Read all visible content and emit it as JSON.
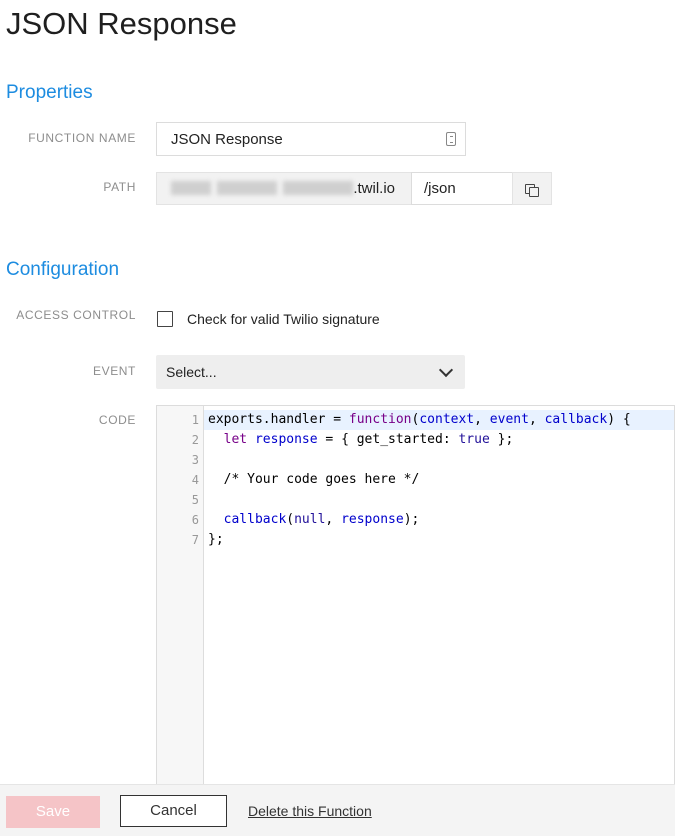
{
  "page": {
    "title": "JSON Response"
  },
  "properties": {
    "title": "Properties",
    "function_name": {
      "label": "FUNCTION NAME",
      "value": "JSON Response",
      "icon": "contact-card-icon"
    },
    "path": {
      "label": "PATH",
      "domain_suffix": ".twil.io",
      "value": "/json",
      "copy_icon": "copy-icon"
    }
  },
  "configuration": {
    "title": "Configuration",
    "access_control": {
      "label": "ACCESS CONTROL",
      "checkbox_label": "Check for valid Twilio signature",
      "checked": false
    },
    "event": {
      "label": "EVENT",
      "selected": "Select..."
    },
    "code": {
      "label": "CODE",
      "line_numbers": [
        "1",
        "2",
        "3",
        "4",
        "5",
        "6",
        "7"
      ],
      "lines": [
        "exports.handler = function(context, event, callback) {",
        "  let response = { get_started: true };",
        "",
        "  /* Your code goes here */",
        "",
        "  callback(null, response);",
        "};"
      ]
    }
  },
  "footer": {
    "save": "Save",
    "cancel": "Cancel",
    "delete": "Delete this Function"
  },
  "colors": {
    "accent": "#1d8ce0",
    "save_disabled": "#f5c4c7"
  }
}
